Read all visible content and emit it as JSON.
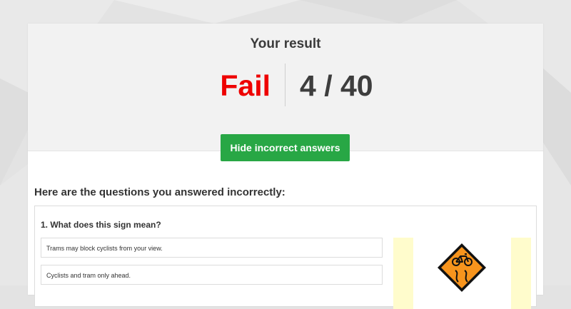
{
  "result": {
    "title": "Your result",
    "verdict": "Fail",
    "score": "4 / 40"
  },
  "actions": {
    "hide_incorrect_label": "Hide incorrect answers"
  },
  "incorrect": {
    "heading": "Here are the questions you answered incorrectly:",
    "questions": [
      {
        "text": "1. What does this sign mean?",
        "options": [
          "Trams may block cyclists from your view.",
          "Cyclists and tram only ahead."
        ],
        "sign_icon": "slippery-for-cyclists-warning-sign-icon"
      }
    ]
  },
  "colors": {
    "fail": "#ee0000",
    "button": "#28a745",
    "sign_orange": "#f7941d",
    "image_bg": "#fffccc"
  }
}
